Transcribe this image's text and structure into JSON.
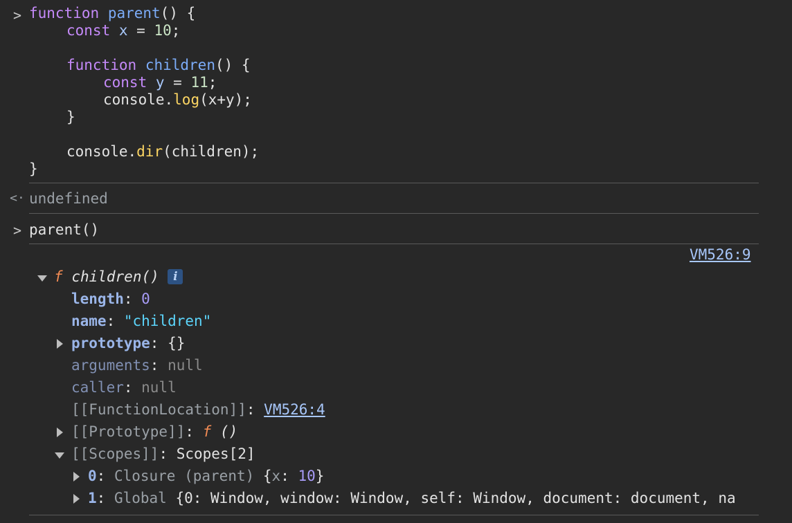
{
  "console": {
    "input_prompt": ">",
    "output_prompt": "<·",
    "code_input": {
      "line1": {
        "kw": "function",
        "name": "parent",
        "rest": "() {"
      },
      "line2": {
        "kw": "const",
        "var": "x",
        "eq": " = ",
        "num": "10",
        "end": ";"
      },
      "line4": {
        "kw": "function",
        "name": "children",
        "rest": "() {"
      },
      "line5": {
        "kw": "const",
        "var": "y",
        "eq": " = ",
        "num": "11",
        "end": ";"
      },
      "line6": {
        "obj": "console.",
        "method": "log",
        "args": "(x+y);"
      },
      "line7": "}",
      "line9": {
        "obj": "console.",
        "method": "dir",
        "args": "(children);"
      },
      "line10": "}"
    },
    "result1": "undefined",
    "command2": "parent()",
    "source_link": "VM526:9",
    "dir_output": {
      "f_symbol": "f",
      "func_signature": "children()",
      "info_badge": "i",
      "length": {
        "key": "length",
        "value": "0"
      },
      "name": {
        "key": "name",
        "value": "\"children\""
      },
      "prototype": {
        "key": "prototype",
        "value": "{}"
      },
      "arguments": {
        "key": "arguments",
        "value": "null"
      },
      "caller": {
        "key": "caller",
        "value": "null"
      },
      "function_location": {
        "key": "[[FunctionLocation]]",
        "value": "VM526:4"
      },
      "proto_internal": {
        "key": "[[Prototype]]",
        "f": "f",
        "value": "()"
      },
      "scopes": {
        "key": "[[Scopes]]",
        "value": "Scopes[2]"
      },
      "scope0": {
        "index": "0",
        "label": "Closure (parent) ",
        "open": "{",
        "k": "x",
        "v": "10",
        "close": "}"
      },
      "scope1": {
        "index": "1",
        "label": "Global ",
        "preview": "{0: Window, window: Window, self: Window, document: document, na"
      }
    }
  }
}
